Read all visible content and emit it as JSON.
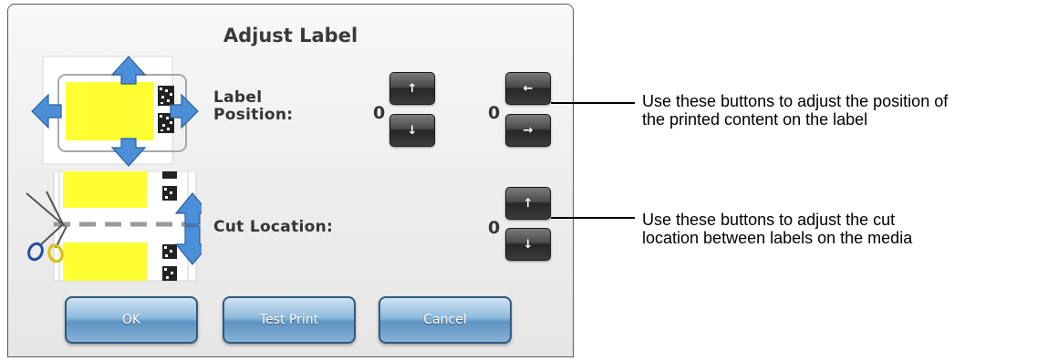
{
  "dialog": {
    "title": "Adjust Label",
    "label_position": {
      "label_line1": "Label",
      "label_line2": "Position:",
      "vertical_value": "0",
      "horizontal_value": "0",
      "up_glyph": "↑",
      "down_glyph": "↓",
      "left_glyph": "←",
      "right_glyph": "→"
    },
    "cut_location": {
      "label": "Cut Location:",
      "value": "0",
      "up_glyph": "↑",
      "down_glyph": "↓"
    },
    "buttons": {
      "ok": "OK",
      "test_print": "Test Print",
      "cancel": "Cancel"
    }
  },
  "callouts": {
    "position": {
      "line1": "Use these buttons to adjust the position of",
      "line2": "the printed content on the label"
    },
    "cut": {
      "line1": "Use these buttons to adjust the cut",
      "line2": "location between labels on the media"
    }
  },
  "colors": {
    "label_yellow": "#ffff33",
    "arrow_blue": "#4a8fd8",
    "button_blue": "#7aa8d2",
    "button_dark": "#3a3a3a"
  }
}
